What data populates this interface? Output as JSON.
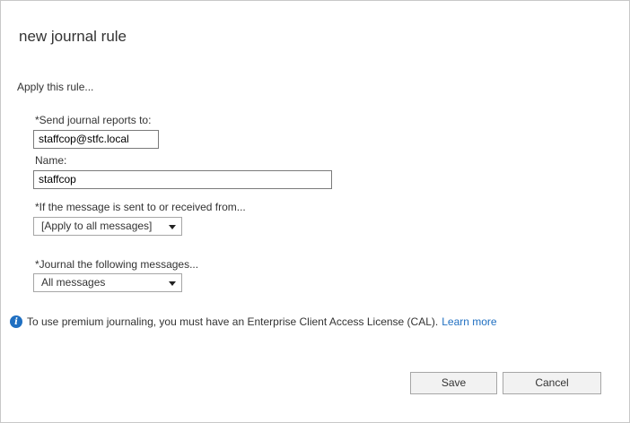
{
  "dialog": {
    "title": "new journal rule",
    "apply_label": "Apply this rule..."
  },
  "form": {
    "send_reports_label": "*Send journal reports to:",
    "send_reports_value": "staffcop@stfc.local",
    "name_label": "Name:",
    "name_value": "staffcop",
    "recipient_label": "*If the message is sent to or received from...",
    "recipient_selected": "[Apply to all messages]",
    "scope_label": "*Journal the following messages...",
    "scope_selected": "All messages"
  },
  "info": {
    "icon": "info-icon",
    "text": "To use premium journaling, you must have an Enterprise Client Access License (CAL).",
    "link": "Learn more"
  },
  "buttons": {
    "save": "Save",
    "cancel": "Cancel"
  },
  "colors": {
    "accent": "#1f6fc1"
  }
}
